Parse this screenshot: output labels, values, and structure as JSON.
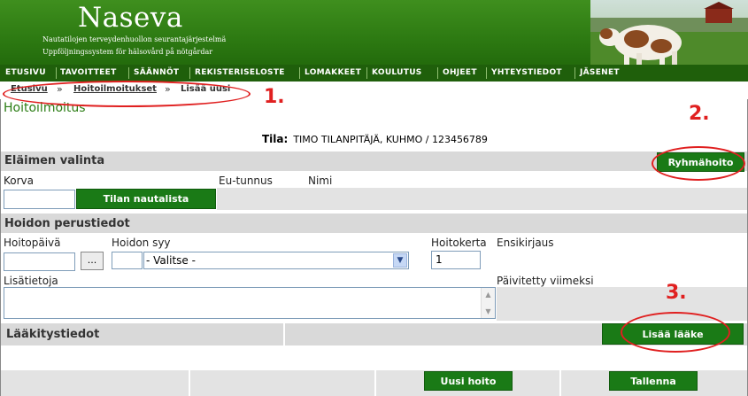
{
  "header": {
    "title": "Naseva",
    "subtitle_fi": "Nautatilojen terveydenhuollon seurantajärjestelmä",
    "subtitle_sv": "Uppföljningssystem för hälsovård på nötgårdar"
  },
  "nav": {
    "items": [
      "ETUSIVU",
      "TAVOITTEET",
      "SÄÄNNÖT",
      "REKISTERISELOSTE",
      "LOMAKKEET",
      "KOULUTUS",
      "OHJEET",
      "YHTEYSTIEDOT",
      "JÄSENET"
    ]
  },
  "breadcrumb": {
    "items": [
      "Etusivu",
      "Hoitoilmoitukset"
    ],
    "separator": "»",
    "current": "Lisää uusi"
  },
  "page": {
    "title": "Hoitoilmoitus",
    "tila_label": "Tila:",
    "tila_value": "TIMO TILANPITÄJÄ, KUHMO / 123456789"
  },
  "animal_selection": {
    "title": "Eläimen valinta",
    "group_button": "Ryhmähoito",
    "korva_label": "Korva",
    "eu_label": "Eu-tunnus",
    "name_label": "Nimi",
    "korva_value": "",
    "list_button": "Tilan nautalista"
  },
  "treatment": {
    "title": "Hoidon perustiedot",
    "date_label": "Hoitopäivä",
    "date_value": "",
    "date_button": "...",
    "reason_label": "Hoidon syy",
    "reason_code": "",
    "reason_select": "- Valitse -",
    "round_label": "Hoitokerta",
    "round_value": "1",
    "first_entry_label": "Ensikirjaus",
    "extra_label": "Lisätietoja",
    "extra_value": "",
    "updated_label": "Päivitetty viimeksi"
  },
  "medication": {
    "title": "Lääkitystiedot",
    "add_button": "Lisää lääke"
  },
  "footer": {
    "new_button": "Uusi hoito",
    "save_button": "Tallenna"
  },
  "annotations": {
    "one": "1.",
    "two": "2.",
    "three": "3."
  },
  "colors": {
    "brand_green": "#1a7a16",
    "header_green": "#2d7a12",
    "title_green": "#2b7d14",
    "annotation_red": "#e02020"
  }
}
